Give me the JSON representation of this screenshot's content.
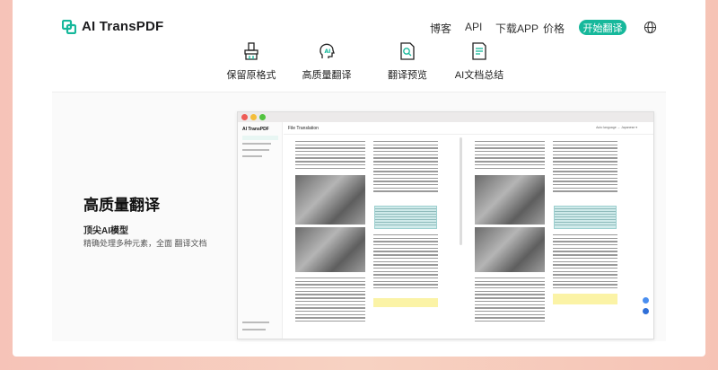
{
  "brand": {
    "name": "AI TransPDF",
    "accent": "#16b89b"
  },
  "nav": {
    "links": [
      "博客",
      "API",
      "下载APP",
      "价格"
    ],
    "cta": "开始翻译",
    "lang_icon": "globe-icon"
  },
  "features": [
    {
      "label": "保留原格式",
      "icon": "brush-icon"
    },
    {
      "label": "高质量翻译",
      "icon": "ai-head-icon"
    },
    {
      "label": "翻译预览",
      "icon": "search-doc-icon"
    },
    {
      "label": "AI文档总结",
      "icon": "summary-doc-icon"
    }
  ],
  "hero": {
    "title": "高质量翻译",
    "subtitle": "顶尖AI模型",
    "description": "精确处理多种元素，全面 翻译文档"
  },
  "preview": {
    "app_name": "AI TransPDF",
    "toolbar_title": "File Translation",
    "language": "Auto language → Japanese ▾"
  }
}
